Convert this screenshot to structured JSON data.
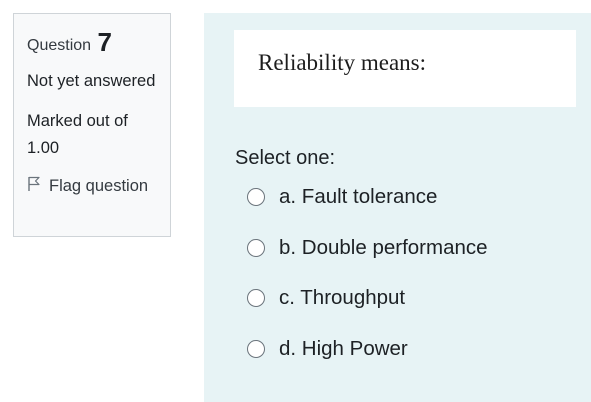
{
  "info": {
    "question_label": "Question",
    "question_number": "7",
    "state": "Not yet answered",
    "grade": "Marked out of 1.00",
    "flag_label": "Flag question"
  },
  "question": {
    "text": "Reliability means:",
    "prompt": "Select one:",
    "options": [
      {
        "letter": "a.",
        "text": "Fault tolerance",
        "label": "a. Fault tolerance",
        "selected": false
      },
      {
        "letter": "b.",
        "text": "Double performance",
        "label": "b. Double performance",
        "selected": false
      },
      {
        "letter": "c.",
        "text": "Throughput",
        "label": "c. Throughput",
        "selected": false
      },
      {
        "letter": "d.",
        "text": "High Power",
        "label": "d. High Power",
        "selected": false
      }
    ]
  },
  "colors": {
    "info_background": "#f8f9fa",
    "content_background": "#e7f3f5",
    "border": "#cfd4d8",
    "text": "#1d2125"
  }
}
